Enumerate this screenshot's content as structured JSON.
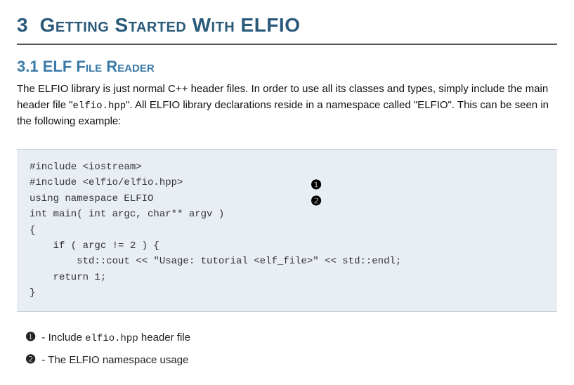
{
  "chapter": {
    "number": "3",
    "title": "Getting Started With ELFIO"
  },
  "section": {
    "number": "3.1",
    "title": "ELF File Reader"
  },
  "paragraph": {
    "part1": "The ELFIO library is just normal C++ header files. In order to use all its classes and types, simply include the main header file \"",
    "code1": "elfio.hpp",
    "part2": "\". All ELFIO library declarations reside in a namespace called \"ELFIO\". This can be seen in the following example:"
  },
  "code": {
    "l1": "#include <iostream>",
    "l2": "#include <elfio/elfio.hpp>",
    "l3": "",
    "l4": "using namespace ELFIO",
    "l5": "",
    "l6": "int main( int argc, char** argv )",
    "l7": "{",
    "l8": "    if ( argc != 2 ) {",
    "l9": "        std::cout << \"Usage: tutorial <elf_file>\" << std::endl;",
    "l10": "    return 1;",
    "l11": "}"
  },
  "callout_marks": {
    "m1": "❶",
    "m2": "❷"
  },
  "callouts": {
    "item1": {
      "mark": "❶",
      "text_before": " - Include ",
      "code": "elfio.hpp",
      "text_after": " header file"
    },
    "item2": {
      "mark": "❷",
      "text": " - The ELFIO namespace usage"
    }
  }
}
